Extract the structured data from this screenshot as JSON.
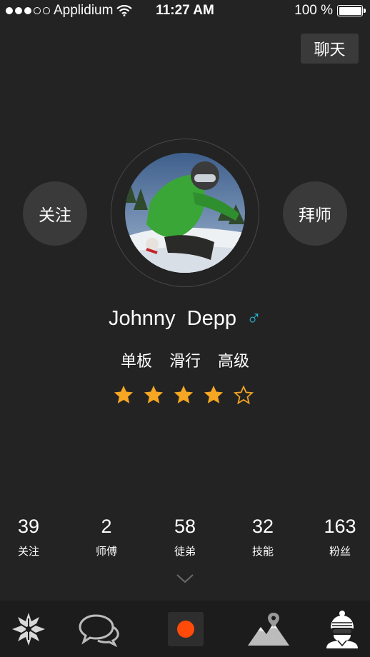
{
  "status_bar": {
    "carrier": "Applidium",
    "time": "11:27 AM",
    "battery": "100 %"
  },
  "header": {
    "chat_label": "聊天"
  },
  "profile": {
    "follow_label": "关注",
    "master_label": "拜师",
    "first_name": "Johnny",
    "last_name": "Depp",
    "gender_symbol": "♂",
    "tags": [
      "单板",
      "滑行",
      "高级"
    ],
    "rating": 4,
    "rating_max": 5
  },
  "stats": [
    {
      "value": "39",
      "label": "关注"
    },
    {
      "value": "2",
      "label": "师傅"
    },
    {
      "value": "58",
      "label": "徒弟"
    },
    {
      "value": "32",
      "label": "技能"
    },
    {
      "value": "163",
      "label": "粉丝"
    }
  ],
  "tabbar": {
    "items": [
      "snowflake-icon",
      "chat-bubbles-icon",
      "record-icon",
      "mountain-pin-icon",
      "profile-avatar-icon"
    ]
  },
  "colors": {
    "accent_star": "#f5a623",
    "record": "#ff4a0a",
    "gender": "#29b8d8",
    "background": "#232323"
  }
}
